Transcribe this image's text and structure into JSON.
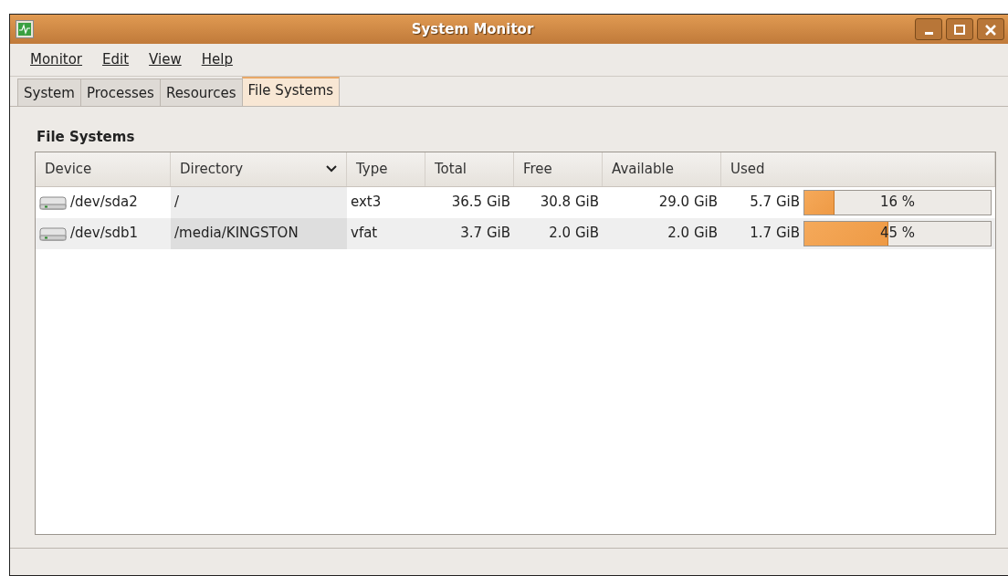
{
  "window": {
    "title": "System Monitor"
  },
  "menu": [
    "Monitor",
    "Edit",
    "View",
    "Help"
  ],
  "tabs": [
    {
      "label": "System",
      "selected": false
    },
    {
      "label": "Processes",
      "selected": false
    },
    {
      "label": "Resources",
      "selected": false
    },
    {
      "label": "File Systems",
      "selected": true
    }
  ],
  "section_title": "File Systems",
  "table": {
    "columns": [
      {
        "label": "Device",
        "sorted": false
      },
      {
        "label": "Directory",
        "sorted": true
      },
      {
        "label": "Type",
        "sorted": false
      },
      {
        "label": "Total",
        "sorted": false
      },
      {
        "label": "Free",
        "sorted": false
      },
      {
        "label": "Available",
        "sorted": false
      },
      {
        "label": "Used",
        "sorted": false
      }
    ],
    "rows": [
      {
        "device": "/dev/sda2",
        "directory": "/",
        "type": "ext3",
        "total": "36.5 GiB",
        "free": "30.8 GiB",
        "available": "29.0 GiB",
        "used": "5.7 GiB",
        "level": 0.16,
        "percent": "16 %"
      },
      {
        "device": "/dev/sdb1",
        "directory": "/media/KINGSTON",
        "type": "vfat",
        "total": "3.7 GiB",
        "free": "2.0 GiB",
        "available": "2.0 GiB",
        "used": "1.7 GiB",
        "level": 0.45,
        "percent": "45 %"
      }
    ]
  }
}
